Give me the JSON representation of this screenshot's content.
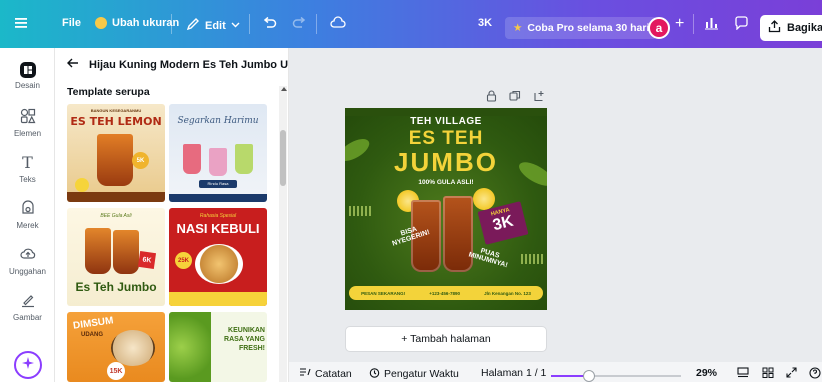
{
  "topbar": {
    "menu_icon": "hamburger-icon",
    "file_label": "File",
    "resize_label": "Ubah ukuran",
    "edit_label": "Edit",
    "count_label": "3K",
    "pro_label": "Coba Pro selama 30 hari",
    "avatar_letter": "a",
    "share_label": "Bagikan"
  },
  "rail": {
    "items": [
      {
        "label": "Desain",
        "icon": "design-icon"
      },
      {
        "label": "Elemen",
        "icon": "elements-icon"
      },
      {
        "label": "Teks",
        "icon": "text-icon"
      },
      {
        "label": "Merek",
        "icon": "brand-icon"
      },
      {
        "label": "Unggahan",
        "icon": "upload-icon"
      },
      {
        "label": "Gambar",
        "icon": "draw-icon"
      }
    ]
  },
  "panel": {
    "title": "Hijau Kuning Modern Es Teh Jumbo UMK...",
    "section_title": "Template serupa",
    "templates": [
      {
        "title": "ES TEH LEMON",
        "subtitle": "BANGUN KESEGARANMU",
        "badge": "5K"
      },
      {
        "title": "Segarkan Harimu",
        "subtitle": "Rindu Rasa"
      },
      {
        "title": "Es Teh Jumbo",
        "subtitle": "BEE Gula Asli",
        "badge": "6K"
      },
      {
        "title": "NASI KEBULI",
        "subtitle": "Rahasia Spesial",
        "badge": "25K"
      },
      {
        "title": "DIMSUM",
        "subtitle": "UDANG",
        "badge": "15K"
      },
      {
        "title": "KEUNIKAN RASA YANG FRESH!"
      }
    ]
  },
  "canvas": {
    "brand": "TEH VILLAGE",
    "title_line1": "ES TEH",
    "title_line2": "JUMBO",
    "tagline": "100% GULA ASLI!",
    "price_label": "HANYA",
    "price": "3K",
    "left_badge_line1": "BISA",
    "left_badge_line2": "NYEGERIN!",
    "right_badge_line1": "PUAS",
    "right_badge_line2": "MINUMNYA!",
    "footer_cta": "PESAN SEKARANG!",
    "footer_phone": "+123-456-7890",
    "footer_address": "Jln Kenangan No. 123"
  },
  "workspace": {
    "add_page_label": "+ Tambah halaman"
  },
  "bottombar": {
    "notes_label": "Catatan",
    "timer_label": "Pengatur Waktu",
    "page_label": "Halaman 1 / 1",
    "zoom_label": "29%",
    "zoom_fraction": 0.29
  },
  "colors": {
    "accent": "#8b3dff",
    "canvas_green": "#2f5a10",
    "canvas_yellow": "#f3d33a"
  }
}
